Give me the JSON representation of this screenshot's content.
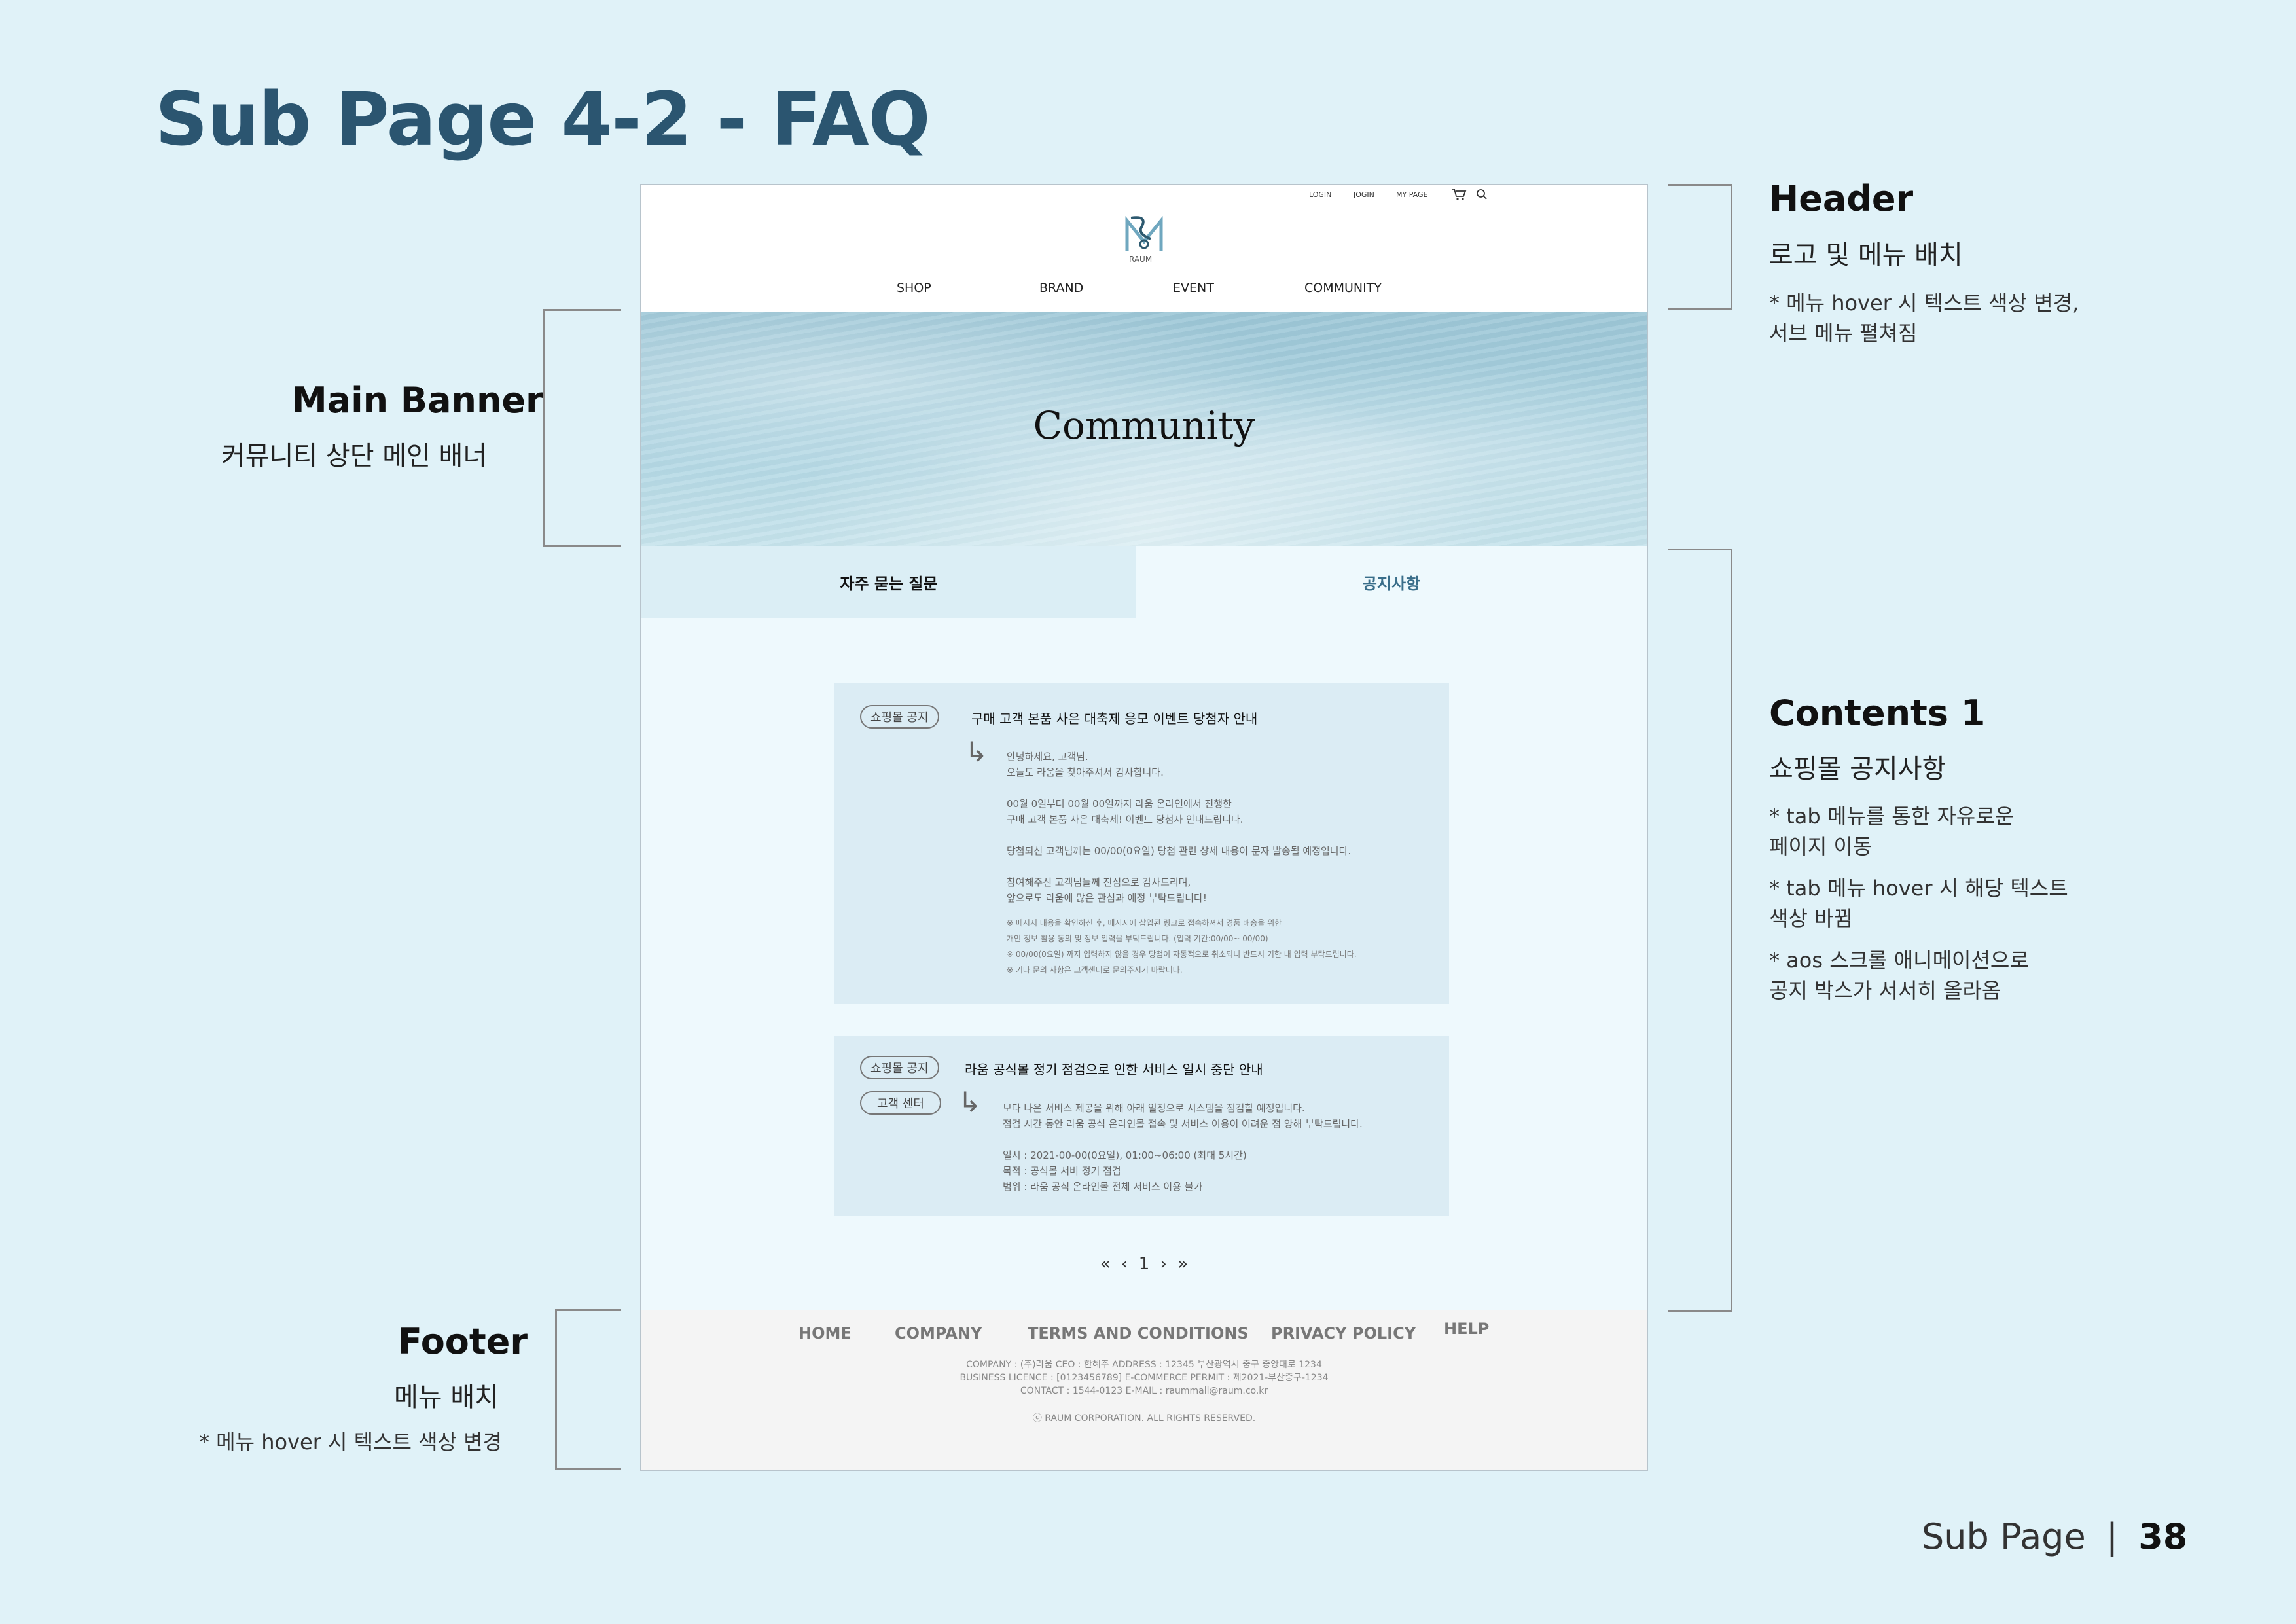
{
  "page_title": "Sub Page 4-2 - FAQ",
  "annotations": {
    "header": {
      "title": "Header",
      "subtitle": "로고 및 메뉴 배치",
      "note1": "* 메뉴 hover 시 텍스트 색상 변경,",
      "note2": "서브 메뉴 펼쳐짐"
    },
    "main_banner": {
      "title": "Main Banner",
      "subtitle": "커뮤니티 상단 메인 배너"
    },
    "contents1": {
      "title": "Contents 1",
      "subtitle": "쇼핑몰 공지사항",
      "note1a": "* tab 메뉴를 통한 자유로운",
      "note1b": "페이지 이동",
      "note2a": "* tab 메뉴 hover 시 해당 텍스트",
      "note2b": "색상  바뀜",
      "note3a": "* aos 스크롤 애니메이션으로",
      "note3b": "공지 박스가 서서히 올라옴"
    },
    "footer": {
      "title": "Footer",
      "subtitle": "메뉴 배치",
      "note": "* 메뉴 hover 시 텍스트 색상 변경"
    }
  },
  "mockup": {
    "utility": {
      "login": "LOGIN",
      "join": "JOGIN",
      "mypage": "MY PAGE",
      "cart_icon": "cart-icon",
      "search_icon": "search-icon"
    },
    "logo_text": "RAUM",
    "nav": [
      "SHOP",
      "BRAND",
      "EVENT",
      "COMMUNITY"
    ],
    "banner_title": "Community",
    "tabs": {
      "faq": "자주 묻는  질문",
      "notice": "공지사항"
    },
    "notices": [
      {
        "badge": "쇼핑몰 공지",
        "title": "구매 고객 본품 사은 대축제 응모 이벤트 당첨자 안내",
        "lines": [
          "안녕하세요, 고객님.",
          "오늘도 라움을 찾아주셔서 감사합니다.",
          "00월 0일부터 00월 00일까지 라움 온라인에서 진행한",
          "구매 고객 본품 사은 대축제! 이벤트 당첨자 안내드립니다.",
          "당첨되신 고객님께는 00/00(0요일) 당첨 관련 상세 내용이 문자 발송될 예정입니다.",
          "참여해주신 고객님들께 진심으로 감사드리며,",
          "앞으로도 라움에 많은 관심과 애정 부탁드립니다!"
        ],
        "small": [
          "※ 메시지 내용을 확인하신 후, 메시지에 삽입된 링크로 접속하셔서 경품 배송을 위한",
          "개인 정보 활용 동의 및 정보 입력을 부탁드립니다. (입력 기간:00/00~ 00/00)",
          "※ 00/00(0요일) 까지 입력하지 않을 경우 당첨이 자동적으로 취소되니 반드시 기한 내 입력 부탁드립니다.",
          "※ 기타 문의 사항은 고객센터로 문의주시기 바랍니다."
        ]
      },
      {
        "badge": "쇼핑몰 공지",
        "badge2": "고객 센터",
        "title": "라움 공식몰 정기 점검으로 인한 서비스 일시 중단 안내",
        "lines": [
          "보다 나은 서비스 제공을 위해 아래 일정으로 시스템을 점검할 예정입니다.",
          "점검 시간 동안 라움 공식 온라인몰 접속 및 서비스 이용이 어려운 점 양해 부탁드립니다.",
          "일시 : 2021-00-00(0요일), 01:00~06:00 (최대 5시간)",
          "목적 : 공식몰 서버 정기 점검",
          "범위 : 라움 공식 온라인몰 전체 서비스 이용 불가"
        ]
      }
    ],
    "pager": {
      "first": "«",
      "prev": "‹",
      "page": "1",
      "next": "›",
      "last": "»"
    },
    "footer": {
      "nav": [
        "HOME",
        "COMPANY",
        "TERMS AND CONDITIONS",
        "PRIVACY POLICY",
        "HELP"
      ],
      "info1": "COMPANY : (주)라움 CEO : 한혜주 ADDRESS : 12345 부산광역시 중구 중앙대로 1234",
      "info2": "BUSINESS LICENCE : [0123456789]   E-COMMERCE PERMIT : 제2021-부산중구-1234",
      "info3": "CONTACT : 1544-0123 E-MAIL : raummall@raum.co.kr",
      "copyright": "ⓒ RAUM CORPORATION. ALL RIGHTS RESERVED."
    }
  },
  "corner": {
    "label": "Sub Page",
    "number": "38"
  }
}
